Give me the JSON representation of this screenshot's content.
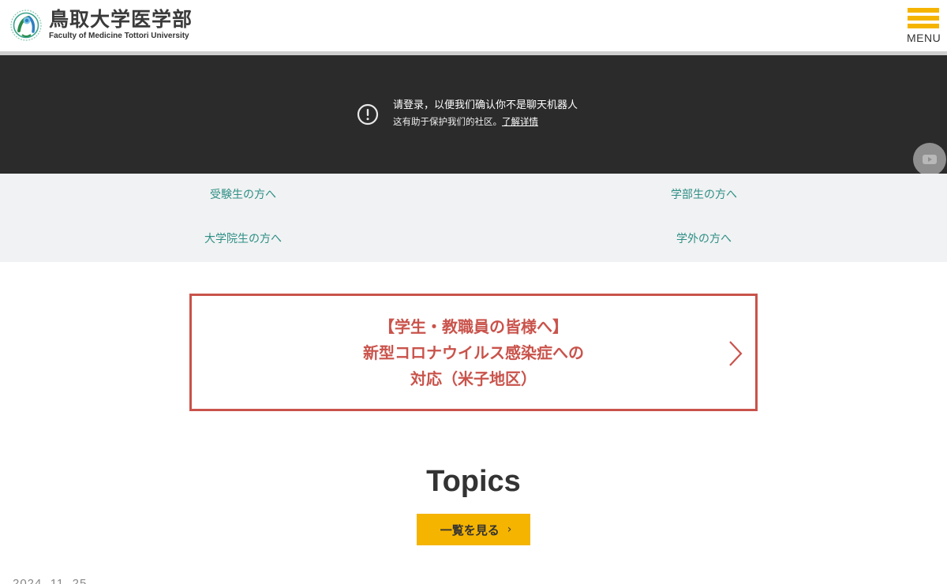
{
  "header": {
    "logo_jp": "鳥取大学医学部",
    "logo_en": "Faculty of Medicine Tottori University",
    "menu_label": "MENU",
    "accent_color": "#f5b400"
  },
  "video": {
    "notice_line1": "请登录，以便我们确认你不是聊天机器人",
    "notice_line2": "这有助于保护我们的社区。",
    "notice_link": "了解详情",
    "play_icon": "youtube-icon"
  },
  "audience": {
    "items": [
      {
        "label": "受験生の方へ"
      },
      {
        "label": "学部生の方へ"
      },
      {
        "label": "大学院生の方へ"
      },
      {
        "label": "学外の方へ"
      }
    ],
    "link_color": "#2d8f86"
  },
  "covid": {
    "line1": "【学生・教職員の皆様へ】",
    "line2": "新型コロナウイルス感染症への",
    "line3": "対応（米子地区）",
    "color": "#c9534b"
  },
  "topics": {
    "title": "Topics",
    "button_label": "一覧を見る",
    "button_chevron": "›",
    "first_date": "2024. 11. 25"
  }
}
